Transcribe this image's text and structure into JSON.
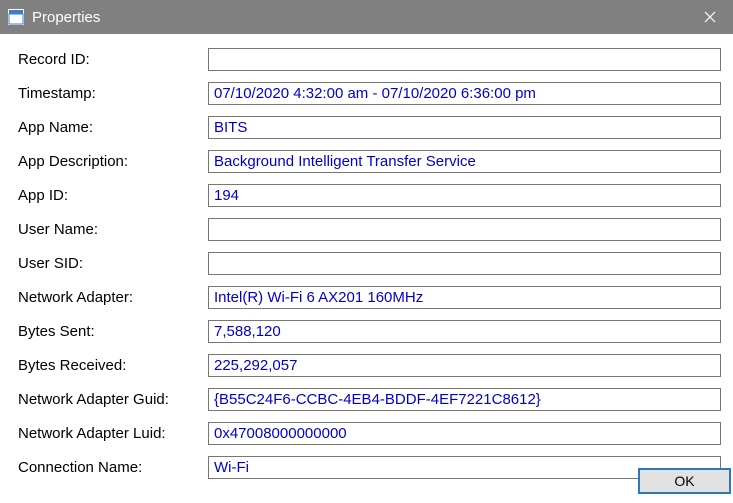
{
  "window": {
    "title": "Properties"
  },
  "fields": [
    {
      "label": "Record ID:",
      "value": ""
    },
    {
      "label": "Timestamp:",
      "value": "07/10/2020 4:32:00 am - 07/10/2020 6:36:00 pm"
    },
    {
      "label": "App Name:",
      "value": "BITS"
    },
    {
      "label": "App Description:",
      "value": "Background Intelligent Transfer Service"
    },
    {
      "label": "App ID:",
      "value": "194"
    },
    {
      "label": "User Name:",
      "value": ""
    },
    {
      "label": "User SID:",
      "value": ""
    },
    {
      "label": "Network Adapter:",
      "value": "Intel(R) Wi-Fi 6 AX201 160MHz"
    },
    {
      "label": "Bytes Sent:",
      "value": "7,588,120"
    },
    {
      "label": "Bytes Received:",
      "value": "225,292,057"
    },
    {
      "label": "Network Adapter Guid:",
      "value": "{B55C24F6-CCBC-4EB4-BDDF-4EF7221C8612}"
    },
    {
      "label": "Network Adapter Luid:",
      "value": "0x47008000000000"
    },
    {
      "label": "Connection Name:",
      "value": "Wi-Fi"
    }
  ],
  "buttons": {
    "ok": "OK"
  }
}
